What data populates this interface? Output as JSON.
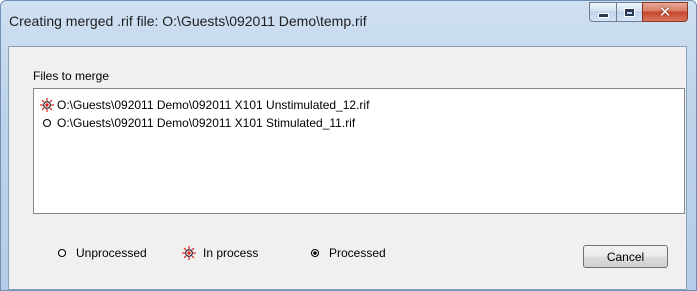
{
  "window": {
    "title": "Creating merged .rif file:  O:\\Guests\\092011 Demo\\temp.rif",
    "buttons": {
      "minimize": "minimize-icon",
      "maximize": "maximize-icon",
      "close": "close-icon",
      "close_glyph": "✕"
    }
  },
  "files": {
    "label": "Files to merge",
    "items": [
      {
        "status": "in-process",
        "icon": "in-process-icon",
        "path": "O:\\Guests\\092011 Demo\\092011 X101 Unstimulated_12.rif"
      },
      {
        "status": "unprocessed",
        "icon": "unprocessed-icon",
        "path": "O:\\Guests\\092011 Demo\\092011 X101 Stimulated_11.rif"
      }
    ]
  },
  "legend": {
    "unprocessed": "Unprocessed",
    "in_process": "In process",
    "processed": "Processed"
  },
  "actions": {
    "cancel": "Cancel"
  },
  "colors": {
    "in_process": "#e02020",
    "status_ring": "#000000"
  }
}
